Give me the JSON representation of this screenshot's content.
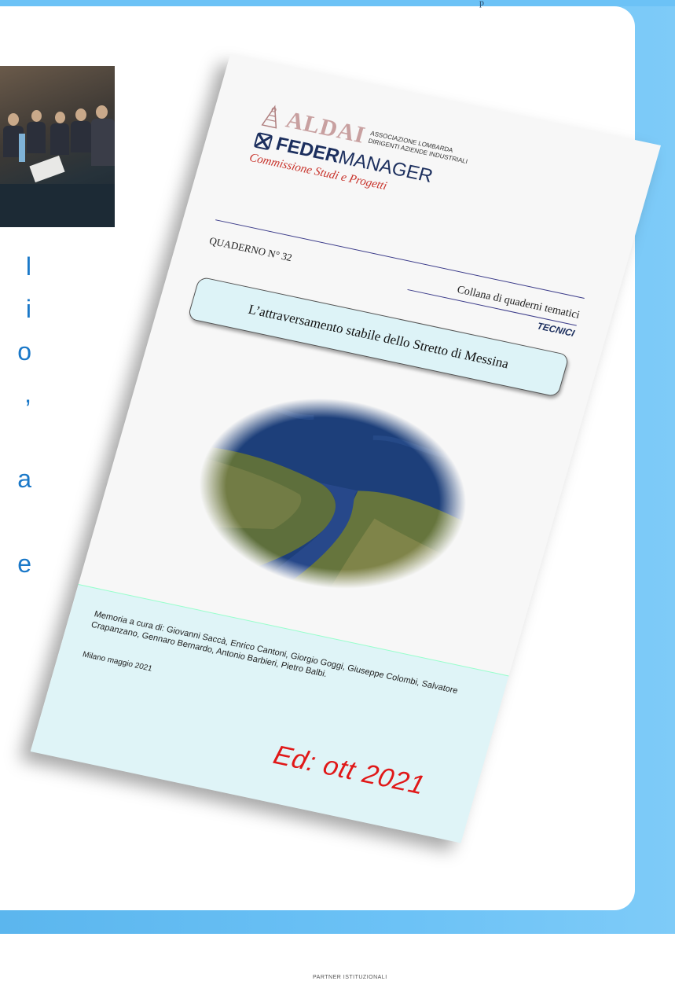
{
  "top_strip_text": "p",
  "left_text_lines": [
    "l",
    "i",
    "o",
    ",",
    "",
    "a",
    "",
    "e"
  ],
  "document": {
    "aldai": "ALDAI",
    "aldai_sub_1": "ASSOCIAZIONE LOMBARDA",
    "aldai_sub_2": "DIRIGENTI AZIENDE INDUSTRIALI",
    "federmanager_bold": "FEDER",
    "federmanager_rest": "MANAGER",
    "commissione": "Commissione Studi e Progetti",
    "quaderno": "QUADERNO N° 32",
    "collana": "Collana di quaderni tematici",
    "tecnici": "TECNICI",
    "title": "L’attraversamento stabile dello Stretto di Messina",
    "memoria": "Memoria a cura di: Giovanni Saccà, Enrico Cantoni, Giorgio Goggi, Giuseppe Colombi, Salvatore Crapanzano, Gennaro Bernardo, Antonio Barbieri, Pietro Balbi.",
    "milano": "Milano maggio 2021",
    "edition": "Ed: ott 2021"
  },
  "footer_label": "PARTNER ISTITUZIONALI",
  "colors": {
    "accent_blue": "#1a78c8",
    "edition_red": "#e01818",
    "commissione_red": "#c8322a",
    "federmanager_navy": "#1c2f5e",
    "title_box_bg": "#ddf3f7"
  }
}
